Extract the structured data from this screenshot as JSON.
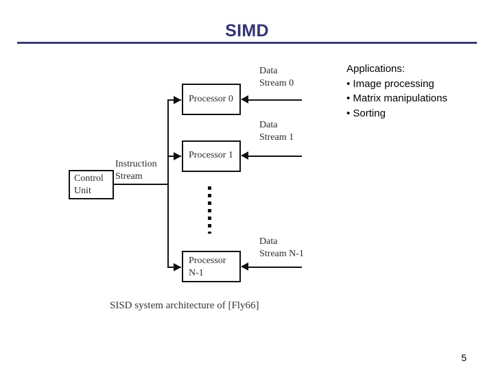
{
  "slide": {
    "title": "SIMD",
    "page_number": "5",
    "accent_color": "#333377",
    "rule_color": "#3b3b7a"
  },
  "diagram": {
    "caption": "SISD system architecture of [Fly66]",
    "control_unit": {
      "label": "Control\nUnit"
    },
    "instruction_stream": {
      "label": "Instruction\nStream"
    },
    "processors": [
      {
        "label": "Processor 0",
        "data_stream": "Data\nStream 0"
      },
      {
        "label": "Processor 1",
        "data_stream": "Data\nStream 1"
      },
      {
        "label": "Processor\nN-1",
        "data_stream": "Data\nStream N-1"
      }
    ]
  },
  "applications": {
    "heading": "Applications:",
    "items": [
      "• Image processing",
      "• Matrix manipulations",
      "• Sorting"
    ]
  }
}
